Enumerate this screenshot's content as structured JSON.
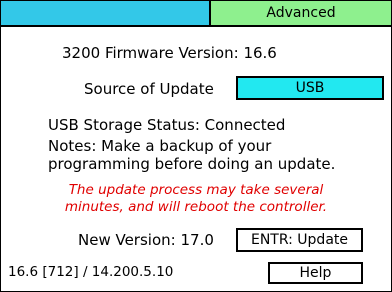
{
  "tabs": {
    "left_label": "",
    "right_label": "Advanced"
  },
  "firmware": {
    "label": "3200 Firmware Version:",
    "value": "16.6"
  },
  "source": {
    "label": "Source of Update",
    "value": "USB"
  },
  "storage": {
    "label": "USB Storage Status:",
    "value": "Connected"
  },
  "notes": {
    "line1": "Notes: Make a backup of your",
    "line2": "programming before doing an update."
  },
  "warning": {
    "line1": "The update process may take several",
    "line2": "minutes, and will reboot the controller."
  },
  "new_version": {
    "label": "New Version:",
    "value": "17.0"
  },
  "update_button": "ENTR: Update",
  "footer": {
    "version_info": "16.6 [712] / 14.200.5.10",
    "help_label": "Help"
  },
  "colors": {
    "tab_left": "#33c8e8",
    "tab_right": "#8ef08e",
    "usb_box": "#22e8f0",
    "warning_text": "#e00000"
  }
}
